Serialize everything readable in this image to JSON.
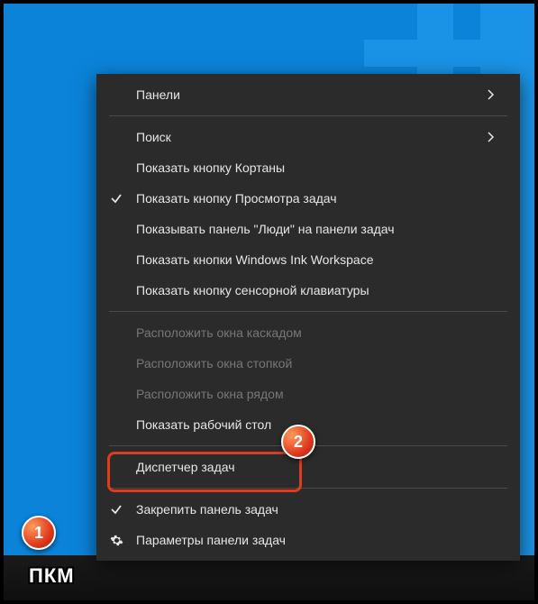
{
  "menu": {
    "items": [
      {
        "label": "Панели",
        "submenu": true
      },
      {
        "sep": true
      },
      {
        "label": "Поиск",
        "submenu": true
      },
      {
        "label": "Показать кнопку Кортаны"
      },
      {
        "label": "Показать кнопку Просмотра задач",
        "checked": true
      },
      {
        "label": "Показывать панель \"Люди\" на панели задач"
      },
      {
        "label": "Показать кнопки Windows Ink Workspace"
      },
      {
        "label": "Показать кнопку сенсорной клавиатуры"
      },
      {
        "sep": true
      },
      {
        "label": "Расположить окна каскадом",
        "disabled": true
      },
      {
        "label": "Расположить окна стопкой",
        "disabled": true
      },
      {
        "label": "Расположить окна рядом",
        "disabled": true
      },
      {
        "label": "Показать рабочий стол"
      },
      {
        "sep": true
      },
      {
        "label": "Диспетчер задач",
        "highlight": true
      },
      {
        "sep": true
      },
      {
        "label": "Закрепить панель задач",
        "checked": true
      },
      {
        "label": "Параметры панели задач",
        "gear": true
      }
    ]
  },
  "annotations": {
    "step1_num": "1",
    "step1_caption": "ПКМ",
    "step2_num": "2"
  }
}
